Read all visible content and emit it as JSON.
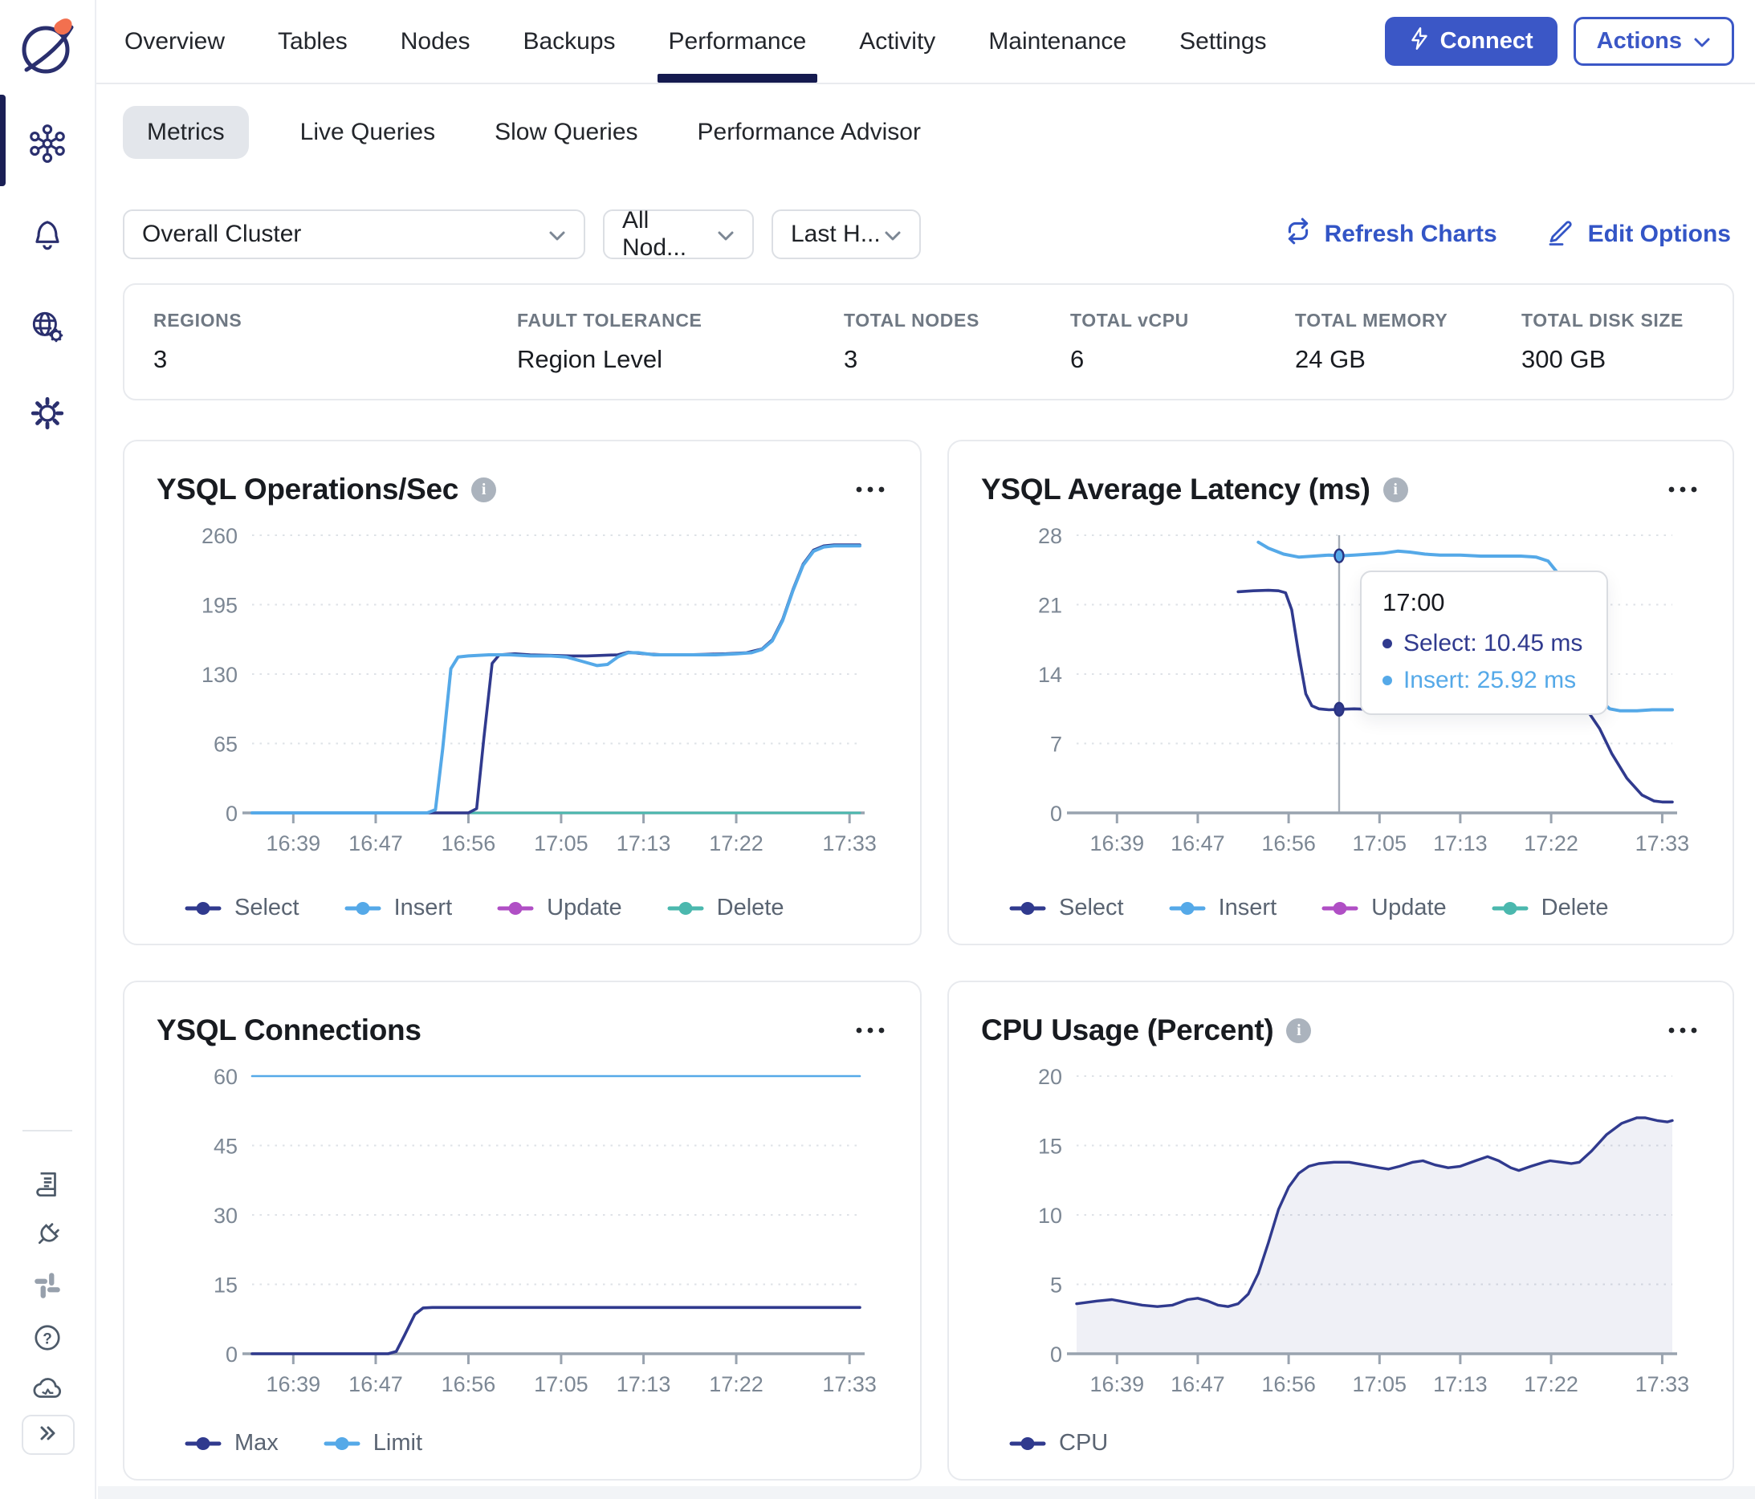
{
  "header": {
    "tabs": [
      "Overview",
      "Tables",
      "Nodes",
      "Backups",
      "Performance",
      "Activity",
      "Maintenance",
      "Settings"
    ],
    "active_tab": "Performance",
    "connect_label": "Connect",
    "actions_label": "Actions"
  },
  "subtabs": {
    "items": [
      "Metrics",
      "Live Queries",
      "Slow Queries",
      "Performance Advisor"
    ],
    "active": "Metrics"
  },
  "filters": {
    "cluster_value": "Overall Cluster",
    "nodes_value": "All Nod...",
    "time_value": "Last H...",
    "refresh_label": "Refresh Charts",
    "edit_label": "Edit Options"
  },
  "stats": [
    {
      "label": "REGIONS",
      "value": "3"
    },
    {
      "label": "FAULT TOLERANCE",
      "value": "Region Level"
    },
    {
      "label": "TOTAL NODES",
      "value": "3"
    },
    {
      "label": "TOTAL vCPU",
      "value": "6"
    },
    {
      "label": "TOTAL MEMORY",
      "value": "24 GB"
    },
    {
      "label": "TOTAL DISK SIZE",
      "value": "300 GB"
    }
  ],
  "sidebar": {
    "top_icons": [
      "cluster-icon",
      "bell-icon",
      "globe-gear-icon",
      "gear-icon"
    ],
    "active_icon": "cluster-icon",
    "bottom_icons": [
      "book-icon",
      "plug-icon",
      "slack-icon",
      "help-icon",
      "cloud-icon"
    ]
  },
  "colors": {
    "navy": "#303A8E",
    "blue": "#55A9E8",
    "magenta": "#B04FC5",
    "teal": "#4BB8AE",
    "accent": "#3355C6",
    "button": "#3B57C6",
    "axis_text": "#7C8794",
    "axis_line": "#99A3AF",
    "grid": "#DEE2E7",
    "area_fill": "rgba(48,58,142,0.08)"
  },
  "chart_data": [
    {
      "type": "line",
      "title": "YSQL Operations/Sec",
      "info": true,
      "ylim": [
        0,
        260
      ],
      "yticks": [
        0,
        65,
        130,
        195,
        260
      ],
      "xticks": [
        {
          "t": 4,
          "label": "16:39"
        },
        {
          "t": 12,
          "label": "16:47"
        },
        {
          "t": 21,
          "label": "16:56"
        },
        {
          "t": 30,
          "label": "17:05"
        },
        {
          "t": 38,
          "label": "17:13"
        },
        {
          "t": 47,
          "label": "17:22"
        },
        {
          "t": 58,
          "label": "17:33"
        }
      ],
      "grid": true,
      "legend_position": "bottom-left",
      "draw_order": [
        2,
        3,
        0,
        1
      ],
      "series": [
        {
          "name": "Select",
          "color": "#303A8E",
          "width": 3.6,
          "points": [
            [
              -1,
              0
            ],
            [
              20,
              0
            ],
            [
              20.8,
              4
            ],
            [
              21.5,
              70
            ],
            [
              22.3,
              140
            ],
            [
              23,
              148
            ],
            [
              24.5,
              149
            ],
            [
              26,
              148
            ],
            [
              28,
              147.5
            ],
            [
              30,
              147
            ],
            [
              31.5,
              147
            ],
            [
              33,
              147.5
            ],
            [
              34.5,
              148
            ],
            [
              35.5,
              150.5
            ],
            [
              37,
              149
            ],
            [
              39,
              148
            ],
            [
              41,
              148
            ],
            [
              43,
              148.5
            ],
            [
              45,
              149
            ],
            [
              47,
              150
            ],
            [
              48.5,
              153.5
            ],
            [
              49.5,
              162
            ],
            [
              50.5,
              181
            ],
            [
              51.5,
              209
            ],
            [
              52.5,
              233
            ],
            [
              53.5,
              246
            ],
            [
              54.5,
              250
            ],
            [
              55.5,
              251
            ],
            [
              58,
              251
            ]
          ]
        },
        {
          "name": "Insert",
          "color": "#55A9E8",
          "width": 4,
          "points": [
            [
              -1,
              0
            ],
            [
              16,
              0
            ],
            [
              16.8,
              3
            ],
            [
              17.5,
              60
            ],
            [
              18.3,
              135
            ],
            [
              19,
              146
            ],
            [
              20,
              147
            ],
            [
              22,
              148
            ],
            [
              24,
              148
            ],
            [
              26,
              147
            ],
            [
              28,
              147
            ],
            [
              29.5,
              146
            ],
            [
              31,
              142
            ],
            [
              32.5,
              138
            ],
            [
              33.5,
              139
            ],
            [
              34.5,
              146
            ],
            [
              35.5,
              150
            ],
            [
              36.5,
              150
            ],
            [
              38,
              148
            ],
            [
              40,
              148
            ],
            [
              42,
              148
            ],
            [
              44,
              148
            ],
            [
              46,
              149
            ],
            [
              47.5,
              150
            ],
            [
              48.5,
              153
            ],
            [
              49.5,
              161
            ],
            [
              50.5,
              180
            ],
            [
              51.5,
              208
            ],
            [
              52.5,
              232
            ],
            [
              53.5,
              245
            ],
            [
              54.5,
              249
            ],
            [
              55.5,
              250
            ],
            [
              58,
              250
            ]
          ]
        },
        {
          "name": "Update",
          "color": "#B04FC5",
          "width": 3,
          "points": [
            [
              -1,
              0
            ],
            [
              58,
              0
            ]
          ]
        },
        {
          "name": "Delete",
          "color": "#4BB8AE",
          "width": 3,
          "points": [
            [
              -1,
              0
            ],
            [
              58,
              0
            ]
          ]
        }
      ]
    },
    {
      "type": "line",
      "title": "YSQL Average Latency (ms)",
      "info": true,
      "ylim": [
        0,
        28
      ],
      "yticks": [
        0,
        7,
        14,
        21,
        28
      ],
      "xticks": [
        {
          "t": 4,
          "label": "16:39"
        },
        {
          "t": 12,
          "label": "16:47"
        },
        {
          "t": 21,
          "label": "16:56"
        },
        {
          "t": 30,
          "label": "17:05"
        },
        {
          "t": 38,
          "label": "17:13"
        },
        {
          "t": 47,
          "label": "17:22"
        },
        {
          "t": 58,
          "label": "17:33"
        }
      ],
      "grid": true,
      "legend_position": "bottom-left",
      "draw_order": [
        2,
        3,
        0,
        1
      ],
      "series": [
        {
          "name": "Select",
          "color": "#303A8E",
          "width": 3.6,
          "points": [
            [
              15,
              22.3
            ],
            [
              16.5,
              22.4
            ],
            [
              18,
              22.45
            ],
            [
              19,
              22.4
            ],
            [
              19.7,
              22.2
            ],
            [
              20.3,
              20.5
            ],
            [
              21,
              16
            ],
            [
              21.7,
              12
            ],
            [
              22.3,
              10.8
            ],
            [
              23,
              10.5
            ],
            [
              24,
              10.4
            ],
            [
              25,
              10.45
            ],
            [
              26.5,
              10.5
            ],
            [
              28,
              10.45
            ],
            [
              29.5,
              10.55
            ],
            [
              30.8,
              10.9
            ],
            [
              31.8,
              10.75
            ],
            [
              33,
              10.6
            ],
            [
              35,
              10.6
            ],
            [
              37,
              10.65
            ],
            [
              39,
              10.6
            ],
            [
              41,
              10.6
            ],
            [
              43,
              10.55
            ],
            [
              44.5,
              10.55
            ],
            [
              46,
              10.5
            ],
            [
              47.5,
              10.45
            ],
            [
              49,
              10.4
            ],
            [
              49.8,
              10.0
            ],
            [
              50.8,
              8.5
            ],
            [
              52,
              6
            ],
            [
              53.5,
              3.5
            ],
            [
              55,
              1.8
            ],
            [
              56.2,
              1.2
            ],
            [
              57,
              1.1
            ],
            [
              58,
              1.1
            ]
          ]
        },
        {
          "name": "Insert",
          "color": "#55A9E8",
          "width": 4,
          "points": [
            [
              17,
              27.3
            ],
            [
              18,
              26.7
            ],
            [
              19.5,
              26.1
            ],
            [
              21,
              25.8
            ],
            [
              22.5,
              25.9
            ],
            [
              24,
              26.0
            ],
            [
              25,
              25.92
            ],
            [
              26.5,
              26.0
            ],
            [
              28,
              26.1
            ],
            [
              29.5,
              26.2
            ],
            [
              30.8,
              26.4
            ],
            [
              32,
              26.3
            ],
            [
              33.5,
              26.1
            ],
            [
              35,
              26.0
            ],
            [
              37,
              26.0
            ],
            [
              39,
              25.9
            ],
            [
              41,
              25.9
            ],
            [
              43,
              25.9
            ],
            [
              44.5,
              25.8
            ],
            [
              45.7,
              25.4
            ],
            [
              46.8,
              24
            ],
            [
              47.8,
              21
            ],
            [
              48.8,
              17.5
            ],
            [
              49.8,
              14
            ],
            [
              50.8,
              11.4
            ],
            [
              51.8,
              10.5
            ],
            [
              52.8,
              10.3
            ],
            [
              54.5,
              10.3
            ],
            [
              56,
              10.4
            ],
            [
              58,
              10.4
            ]
          ]
        },
        {
          "name": "Update",
          "color": "#B04FC5",
          "width": 3,
          "points": []
        },
        {
          "name": "Delete",
          "color": "#4BB8AE",
          "width": 3,
          "points": []
        }
      ],
      "crosshair": {
        "t": 25,
        "time": "17:00",
        "markers": [
          {
            "name": "Insert",
            "v": 25.92,
            "color": "#55A9E8"
          },
          {
            "name": "Select",
            "v": 10.45,
            "color": "#303A8E"
          }
        ],
        "rows": [
          {
            "text": "Select: 10.45 ms",
            "color": "#303A8E"
          },
          {
            "text": "Insert: 25.92 ms",
            "color": "#55A9E8"
          }
        ]
      }
    },
    {
      "type": "line",
      "title": "YSQL Connections",
      "info": false,
      "ylim": [
        0,
        60
      ],
      "yticks": [
        0,
        15,
        30,
        45,
        60
      ],
      "xticks": [
        {
          "t": 4,
          "label": "16:39"
        },
        {
          "t": 12,
          "label": "16:47"
        },
        {
          "t": 21,
          "label": "16:56"
        },
        {
          "t": 30,
          "label": "17:05"
        },
        {
          "t": 38,
          "label": "17:13"
        },
        {
          "t": 47,
          "label": "17:22"
        },
        {
          "t": 58,
          "label": "17:33"
        }
      ],
      "grid": true,
      "legend_position": "bottom-left",
      "draw_order": [
        1,
        0
      ],
      "series": [
        {
          "name": "Max",
          "color": "#303A8E",
          "width": 3.6,
          "points": [
            [
              -1,
              0
            ],
            [
              12.2,
              0
            ],
            [
              13,
              0.5
            ],
            [
              13.8,
              4
            ],
            [
              14.8,
              8.5
            ],
            [
              15.6,
              9.9
            ],
            [
              16.5,
              10
            ],
            [
              58,
              10
            ]
          ]
        },
        {
          "name": "Limit",
          "color": "#55A9E8",
          "width": 2.6,
          "points": [
            [
              -1,
              60
            ],
            [
              58,
              60
            ]
          ]
        }
      ]
    },
    {
      "type": "area",
      "title": "CPU Usage (Percent)",
      "info": true,
      "ylim": [
        0,
        20
      ],
      "yticks": [
        0,
        5,
        10,
        15,
        20
      ],
      "xticks": [
        {
          "t": 4,
          "label": "16:39"
        },
        {
          "t": 12,
          "label": "16:47"
        },
        {
          "t": 21,
          "label": "16:56"
        },
        {
          "t": 30,
          "label": "17:05"
        },
        {
          "t": 38,
          "label": "17:13"
        },
        {
          "t": 47,
          "label": "17:22"
        },
        {
          "t": 58,
          "label": "17:33"
        }
      ],
      "grid": true,
      "legend_position": "bottom-left",
      "draw_order": [
        0
      ],
      "series": [
        {
          "name": "CPU",
          "color": "#303A8E",
          "width": 3.4,
          "area": true,
          "points": [
            [
              -1,
              3.6
            ],
            [
              1,
              3.8
            ],
            [
              2.5,
              3.9
            ],
            [
              4,
              3.7
            ],
            [
              5.5,
              3.5
            ],
            [
              7,
              3.4
            ],
            [
              8.5,
              3.5
            ],
            [
              10,
              3.9
            ],
            [
              11,
              4.0
            ],
            [
              12,
              3.8
            ],
            [
              13,
              3.5
            ],
            [
              14,
              3.4
            ],
            [
              15,
              3.6
            ],
            [
              16,
              4.3
            ],
            [
              17,
              5.8
            ],
            [
              18,
              8
            ],
            [
              19,
              10.4
            ],
            [
              20,
              12
            ],
            [
              21,
              13
            ],
            [
              22,
              13.5
            ],
            [
              23,
              13.7
            ],
            [
              24.5,
              13.8
            ],
            [
              26,
              13.8
            ],
            [
              27.5,
              13.6
            ],
            [
              29,
              13.4
            ],
            [
              29.9,
              13.3
            ],
            [
              31,
              13.5
            ],
            [
              32.3,
              13.8
            ],
            [
              33.3,
              13.9
            ],
            [
              34.5,
              13.6
            ],
            [
              35.8,
              13.4
            ],
            [
              37,
              13.5
            ],
            [
              38.5,
              13.9
            ],
            [
              39.7,
              14.2
            ],
            [
              40.8,
              13.9
            ],
            [
              42,
              13.4
            ],
            [
              42.8,
              13.2
            ],
            [
              44,
              13.5
            ],
            [
              45.3,
              13.8
            ],
            [
              45.9,
              13.9
            ],
            [
              47,
              13.8
            ],
            [
              48,
              13.7
            ],
            [
              48.8,
              13.8
            ],
            [
              50,
              14.6
            ],
            [
              51.5,
              15.8
            ],
            [
              53,
              16.6
            ],
            [
              54.5,
              17.0
            ],
            [
              55.3,
              17.0
            ],
            [
              56.5,
              16.8
            ],
            [
              57.5,
              16.7
            ],
            [
              58,
              16.8
            ]
          ]
        }
      ]
    }
  ]
}
